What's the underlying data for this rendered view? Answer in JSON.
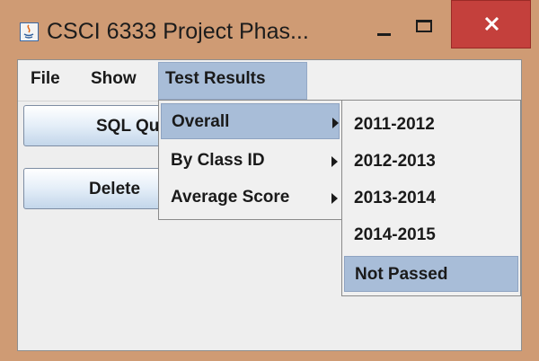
{
  "window": {
    "title": "CSCI 6333 Project Phas...",
    "icon": "java-icon",
    "controls": {
      "minimize_icon": "minimize-icon",
      "maximize_icon": "maximize-icon",
      "close_icon": "close-icon"
    }
  },
  "menubar": {
    "items": [
      {
        "label": "File"
      },
      {
        "label": "Show"
      },
      {
        "label": "Test Results",
        "state": "open"
      }
    ]
  },
  "main": {
    "sql_button_label": "SQL Qu",
    "delete_button_label": "Delete"
  },
  "test_results_menu": {
    "items": [
      {
        "label": "Overall",
        "has_submenu": true,
        "highlighted": true
      },
      {
        "label": "By Class ID",
        "has_submenu": true
      },
      {
        "label": "Average Score",
        "has_submenu": true
      }
    ]
  },
  "overall_submenu": {
    "items": [
      {
        "label": "2011-2012"
      },
      {
        "label": "2012-2013"
      },
      {
        "label": "2013-2014"
      },
      {
        "label": "2014-2015"
      },
      {
        "label": "Not Passed",
        "highlighted": true
      }
    ]
  },
  "colors": {
    "title_bar": "#cf9b74",
    "close_button": "#c4403c",
    "menu_highlight": "#a8bdd8"
  }
}
